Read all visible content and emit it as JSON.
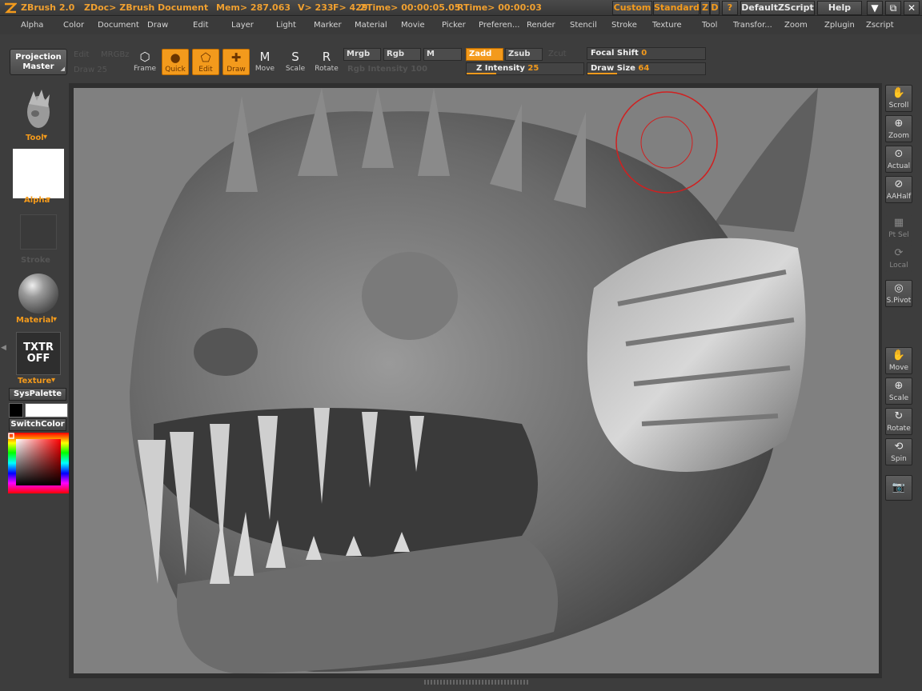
{
  "titlebar": {
    "app": "ZBrush 2.0",
    "document": "ZDoc> ZBrush Document",
    "mem": "Mem> 287.063",
    "v": "V> 233",
    "f": "F> 429",
    "ztime": "ZTime> 00:00:05.05",
    "rtime": "RTime> 00:00:03",
    "custom": "Custom",
    "standard": "Standard",
    "z": "Z",
    "d": "D",
    "q": "?",
    "script": "DefaultZScript",
    "help": "Help",
    "min": "▼",
    "restore": "⧉",
    "close": "✕"
  },
  "menu": [
    "Alpha",
    "Color",
    "Document",
    "Draw",
    "Edit",
    "Layer",
    "Light",
    "Marker",
    "Material",
    "Movie",
    "Picker",
    "Preferen...",
    "Render",
    "Stencil",
    "Stroke",
    "Texture",
    "Tool",
    "Transfor...",
    "Zoom",
    "Zplugin",
    "Zscript"
  ],
  "toolbar": {
    "projection_master_1": "Projection",
    "projection_master_2": "Master",
    "dim_top_1": "Edit",
    "dim_top_2": "MRGBz",
    "dim_bottom": "Draw 25",
    "frame": "Frame",
    "quick": "Quick",
    "edit": "Edit",
    "draw": "Draw",
    "move": "Move",
    "scale": "Scale",
    "rotate": "Rotate",
    "mrgb": "Mrgb",
    "rgb": "Rgb",
    "m": "M",
    "zadd": "Zadd",
    "zsub": "Zsub",
    "zcut": "Zcut",
    "rgb_intensity_label": "Rgb Intensity",
    "rgb_intensity_value": "100",
    "z_intensity_label": "Z Intensity",
    "z_intensity_value": "25",
    "focal_label": "Focal Shift",
    "focal_value": "0",
    "draw_size_label": "Draw Size",
    "draw_size_value": "64"
  },
  "left_tray": {
    "tool": "Tool",
    "alpha": "Alpha",
    "stroke": "Stroke",
    "material": "Material",
    "txtr_1": "TXTR",
    "txtr_2": "OFF",
    "texture": "Texture",
    "syspalette": "SysPalette",
    "switchcolor": "SwitchColor"
  },
  "right_shelf": {
    "scroll": "Scroll",
    "zoom": "Zoom",
    "actual": "Actual",
    "aahalf": "AAHalf",
    "ptsel": "Pt Sel",
    "local": "Local",
    "spivot": "S.Pivot",
    "move": "Move",
    "scale": "Scale",
    "rotate": "Rotate",
    "spin": "Spin"
  },
  "colors": {
    "accent": "#f39a1c",
    "brush_cursor": "#d02020",
    "canvas": "#808080",
    "primary_color": "#000000",
    "secondary_color": "#ffffff"
  },
  "icons": [
    "frame-icon",
    "quick-icon",
    "edit-icon",
    "draw-icon",
    "move-icon",
    "scale-icon",
    "rotate-icon",
    "scroll-icon",
    "zoom-icon",
    "actual-icon",
    "aahalf-icon",
    "ptsel-icon",
    "local-icon",
    "spivot-icon",
    "spin-icon",
    "snapshot-icon"
  ]
}
